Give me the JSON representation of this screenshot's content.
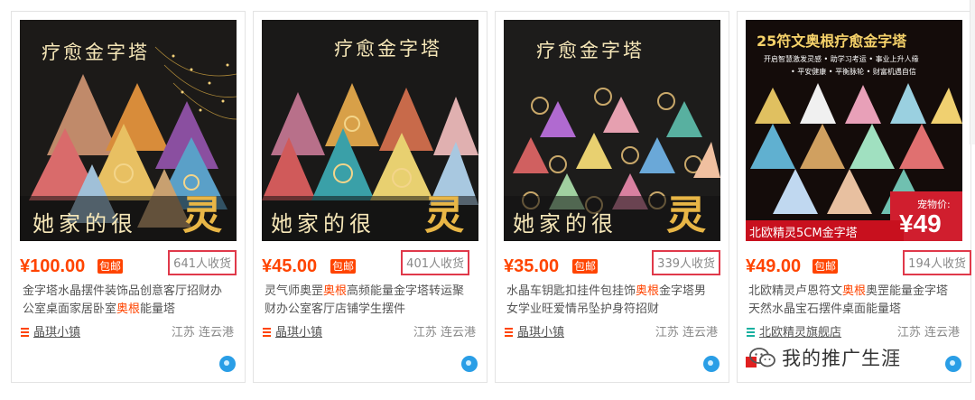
{
  "products": [
    {
      "image": {
        "top": "疗愈金字塔",
        "bottom_left": "她家的很",
        "bottom_big": "灵",
        "sub": ""
      },
      "price": "¥100.00",
      "badge": "包邮",
      "sales": "641人收货",
      "title_before": "金字塔水晶摆件装饰品创意客厅招财办公室桌面家居卧室",
      "title_hl": "奥根",
      "title_after": "能量塔",
      "shop": "晶琪小镇",
      "location": "江苏 连云港",
      "shop_icon": "list-icon"
    },
    {
      "image": {
        "top": "疗愈金字塔",
        "bottom_left": "她家的很",
        "bottom_big": "灵",
        "sub": ""
      },
      "price": "¥45.00",
      "badge": "包邮",
      "sales": "401人收货",
      "title_before": "灵气师奥罡",
      "title_hl": "奥根",
      "title_after": "高频能量金字塔转运聚财办公室客厅店铺学生摆件",
      "shop": "晶琪小镇",
      "location": "江苏 连云港",
      "shop_icon": "list-icon"
    },
    {
      "image": {
        "top": "疗愈金字塔",
        "bottom_left": "她家的很",
        "bottom_big": "灵",
        "sub": ""
      },
      "price": "¥35.00",
      "badge": "包邮",
      "sales": "339人收货",
      "title_before": "水晶车钥匙扣挂件包挂饰",
      "title_hl": "奥根",
      "title_after": "金字塔男女学业旺爱情吊坠护身符招财",
      "shop": "晶琪小镇",
      "location": "江苏 连云港",
      "shop_icon": "list-icon"
    },
    {
      "image": {
        "top": "25符文奥根疗愈金字塔",
        "line1": "开启智慧激发灵感 • 助学习考运 • 事业上升人缘",
        "line2": "• 平安健康 • 平衡脉轮 • 财富机遇自信",
        "promo_label": "宠物价:",
        "promo_price": "¥49",
        "bottom_banner": "北欧精灵5CM金字塔"
      },
      "price": "¥49.00",
      "badge": "包邮",
      "sales": "194人收货",
      "title_before": "北欧精灵卢恩符文",
      "title_hl": "奥根",
      "title_after": "奥罡能量金字塔天然水晶宝石摆件桌面能量塔",
      "shop": "北欧精灵旗舰店",
      "location": "江苏 连云港",
      "shop_icon": "list-icon-teal"
    }
  ],
  "watermark": {
    "text": "我的推广生涯",
    "icon": "wechat-logo-icon"
  },
  "colors": {
    "price": "#ff4400",
    "highlight_box": "#e0394a",
    "wangwang": "#2a9ee6"
  }
}
